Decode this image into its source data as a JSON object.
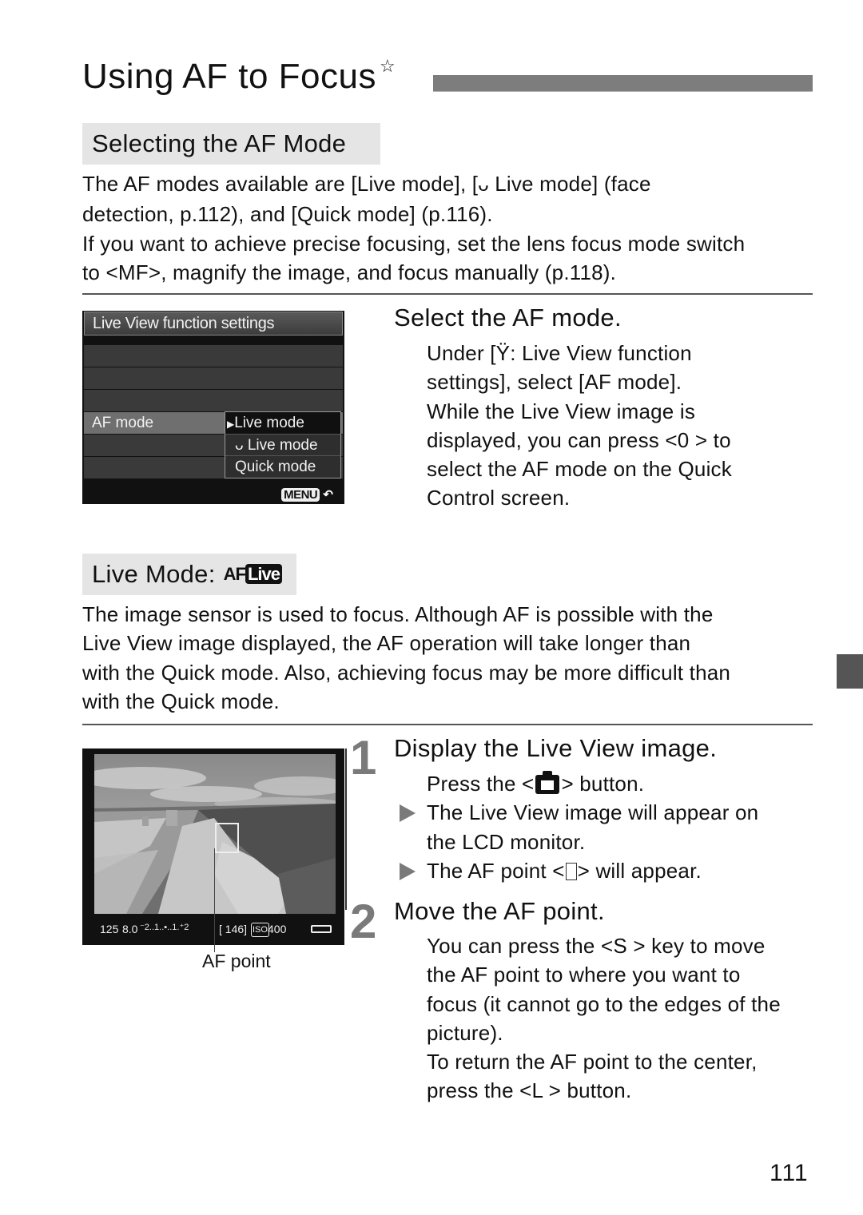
{
  "page": {
    "title": "Using AF to Focus",
    "title_mark": "☆",
    "page_number": "111"
  },
  "section_af_mode": {
    "heading": "Selecting the AF Mode",
    "lines": [
      [
        "The AF modes available are [Live mode], [",
        "ᴗ",
        " Live mode] (face"
      ],
      "detection, p.112), and [Quick mode] (p.116).",
      "If you want to achieve precise focusing, set the lens focus mode switch",
      "to <MF>, magnify the image, and focus manually (p.118)."
    ]
  },
  "camera_menu": {
    "header": "Live View function settings",
    "row_label": "AF mode",
    "options": [
      {
        "marker": "▶",
        "label": "Live mode",
        "selected": true
      },
      {
        "marker": "ᴗ",
        "label": "Live mode",
        "selected": false
      },
      {
        "marker": "",
        "label": "Quick mode",
        "selected": false
      }
    ],
    "menu_button": "MENU",
    "back_icon": "↶"
  },
  "select_step": {
    "heading": "Select the AF mode.",
    "lines": [
      "Under [Ÿ: Live View function",
      "settings], select [AF mode].",
      "While the Live View image is",
      "displayed, you can press <0   > to",
      "select the AF mode on the Quick",
      "Control screen."
    ]
  },
  "section_live_mode": {
    "heading": "Live Mode:",
    "icon_af": "AF",
    "icon_live": "Live",
    "lines": [
      "The image sensor is used to focus. Although AF is possible with the",
      "Live View image displayed, the AF operation will take longer than",
      "with the Quick mode. Also, achieving focus may be more difficult than",
      "with the Quick mode."
    ]
  },
  "live_view_screen": {
    "shutter": "125",
    "aperture": "8.0",
    "exposure_scale": "⁻2..1..▪..1.⁺2",
    "shots": "[ 146]",
    "iso_label": "ISO",
    "iso": "400",
    "callout": "AF point"
  },
  "steps": [
    {
      "number": "1",
      "heading": "Display the Live View image.",
      "intro_before": "Press the <",
      "intro_after": "> button.",
      "bullets": [
        [
          "The Live View image will appear on",
          "the LCD monitor."
        ],
        [
          "The AF point <",
          "> will appear."
        ]
      ]
    },
    {
      "number": "2",
      "heading": "Move the AF point.",
      "lines": [
        "You can press the <S  > key to move",
        "the AF point to where you want to",
        "focus (it cannot go to the edges of the",
        "picture).",
        "To return the AF point to the center,",
        "press the <L  > button."
      ]
    }
  ]
}
